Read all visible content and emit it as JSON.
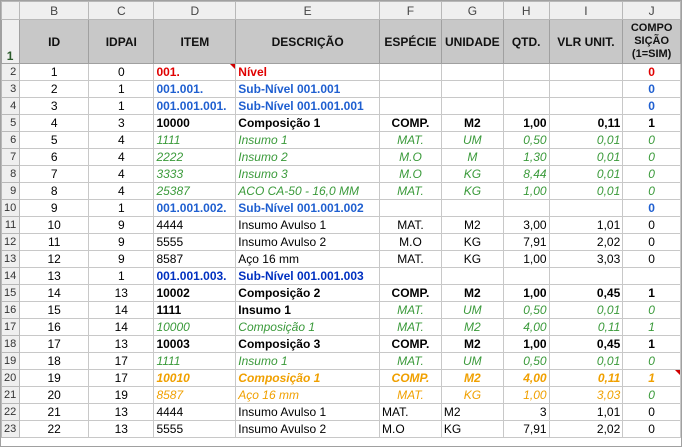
{
  "columns": [
    "B",
    "C",
    "D",
    "E",
    "F",
    "G",
    "H",
    "I",
    "J"
  ],
  "header": {
    "row_number": "1",
    "cells": [
      "ID",
      "IDPAI",
      "ITEM",
      "DESCRIÇÃO",
      "ESPÉCIE",
      "UNIDADE",
      "QTD.",
      "VLR UNIT.",
      "COMPO SIÇÃO (1=SIM)"
    ]
  },
  "rows": [
    {
      "n": "2",
      "id": "1",
      "idpai": "0",
      "item": "001.",
      "desc": "Nível",
      "esp": "",
      "un": "",
      "qtd": "",
      "vlr": "",
      "comp": "0",
      "style": "nivel"
    },
    {
      "n": "3",
      "id": "2",
      "idpai": "1",
      "item": "001.001.",
      "desc": "Sub-Nível 001.001",
      "esp": "",
      "un": "",
      "qtd": "",
      "vlr": "",
      "comp": "0",
      "style": "sub"
    },
    {
      "n": "4",
      "id": "3",
      "idpai": "1",
      "item": "001.001.001.",
      "desc": "Sub-Nível 001.001.001",
      "esp": "",
      "un": "",
      "qtd": "",
      "vlr": "",
      "comp": "0",
      "style": "sub"
    },
    {
      "n": "5",
      "id": "4",
      "idpai": "3",
      "item": "10000",
      "desc": "Composição 1",
      "esp": "COMP.",
      "un": "M2",
      "qtd": "1,00",
      "vlr": "0,11",
      "comp": "1",
      "style": "comp"
    },
    {
      "n": "6",
      "id": "5",
      "idpai": "4",
      "item": "1111",
      "desc": "Insumo 1",
      "esp": "MAT.",
      "un": "UM",
      "qtd": "0,50",
      "vlr": "0,01",
      "comp": "0",
      "style": "ins"
    },
    {
      "n": "7",
      "id": "6",
      "idpai": "4",
      "item": "2222",
      "desc": "Insumo 2",
      "esp": "M.O",
      "un": "M",
      "qtd": "1,30",
      "vlr": "0,01",
      "comp": "0",
      "style": "ins"
    },
    {
      "n": "8",
      "id": "7",
      "idpai": "4",
      "item": "3333",
      "desc": "Insumo 3",
      "esp": "M.O",
      "un": "KG",
      "qtd": "8,44",
      "vlr": "0,01",
      "comp": "0",
      "style": "ins"
    },
    {
      "n": "9",
      "id": "8",
      "idpai": "4",
      "item": "25387",
      "desc": "ACO CA-50 - 16,0 MM",
      "esp": "MAT.",
      "un": "KG",
      "qtd": "1,00",
      "vlr": "0,01",
      "comp": "0",
      "style": "ins"
    },
    {
      "n": "10",
      "id": "9",
      "idpai": "1",
      "item": "001.001.002.",
      "desc": "Sub-Nível 001.001.002",
      "esp": "",
      "un": "",
      "qtd": "",
      "vlr": "",
      "comp": "0",
      "style": "sub"
    },
    {
      "n": "11",
      "id": "10",
      "idpai": "9",
      "item": "4444",
      "desc": "Insumo Avulso 1",
      "esp": "MAT.",
      "un": "M2",
      "qtd": "3,00",
      "vlr": "1,01",
      "comp": "0",
      "style": "plain"
    },
    {
      "n": "12",
      "id": "11",
      "idpai": "9",
      "item": "5555",
      "desc": "Insumo Avulso 2",
      "esp": "M.O",
      "un": "KG",
      "qtd": "7,91",
      "vlr": "2,02",
      "comp": "0",
      "style": "plain"
    },
    {
      "n": "13",
      "id": "12",
      "idpai": "9",
      "item": "8587",
      "desc": "Aço 16 mm",
      "esp": "MAT.",
      "un": "KG",
      "qtd": "1,00",
      "vlr": "3,03",
      "comp": "0",
      "style": "plain"
    },
    {
      "n": "14",
      "id": "13",
      "idpai": "1",
      "item": "001.001.003.",
      "desc": "Sub-Nível 001.001.003",
      "esp": "",
      "un": "",
      "qtd": "",
      "vlr": "",
      "comp": "",
      "style": "sub2"
    },
    {
      "n": "15",
      "id": "14",
      "idpai": "13",
      "item": "10002",
      "desc": "Composição 2",
      "esp": "COMP.",
      "un": "M2",
      "qtd": "1,00",
      "vlr": "0,45",
      "comp": "1",
      "style": "comp"
    },
    {
      "n": "16",
      "id": "15",
      "idpai": "14",
      "item": "1111",
      "desc": "Insumo 1",
      "esp": "MAT.",
      "un": "UM",
      "qtd": "0,50",
      "vlr": "0,01",
      "comp": "0",
      "style": "insb"
    },
    {
      "n": "17",
      "id": "16",
      "idpai": "14",
      "item": "10000",
      "desc": "Composição 1",
      "esp": "MAT.",
      "un": "M2",
      "qtd": "4,00",
      "vlr": "0,11",
      "comp": "1",
      "style": "ins"
    },
    {
      "n": "18",
      "id": "17",
      "idpai": "13",
      "item": "10003",
      "desc": "Composição 3",
      "esp": "COMP.",
      "un": "M2",
      "qtd": "1,00",
      "vlr": "0,45",
      "comp": "1",
      "style": "comp"
    },
    {
      "n": "19",
      "id": "18",
      "idpai": "17",
      "item": "1111",
      "desc": "Insumo 1",
      "esp": "MAT.",
      "un": "UM",
      "qtd": "0,50",
      "vlr": "0,01",
      "comp": "0",
      "style": "ins"
    },
    {
      "n": "20",
      "id": "19",
      "idpai": "17",
      "item": "10010",
      "desc": "Composição 1",
      "esp": "COMP.",
      "un": "M2",
      "qtd": "4,00",
      "vlr": "0,11",
      "comp": "1",
      "style": "orange"
    },
    {
      "n": "21",
      "id": "20",
      "idpai": "19",
      "item": "8587",
      "desc": "Aço 16 mm",
      "esp": "MAT.",
      "un": "KG",
      "qtd": "1,00",
      "vlr": "3,03",
      "comp": "0",
      "style": "orangeit"
    },
    {
      "n": "22",
      "id": "21",
      "idpai": "13",
      "item": "4444",
      "desc": "Insumo Avulso 1",
      "esp": "MAT.",
      "un": "M2",
      "qtd": "3",
      "vlr": "1,01",
      "comp": "0",
      "style": "plainL"
    },
    {
      "n": "23",
      "id": "22",
      "idpai": "13",
      "item": "5555",
      "desc": "Insumo Avulso 2",
      "esp": "M.O",
      "un": "KG",
      "qtd": "7,91",
      "vlr": "2,02",
      "comp": "0",
      "style": "plainL"
    }
  ]
}
